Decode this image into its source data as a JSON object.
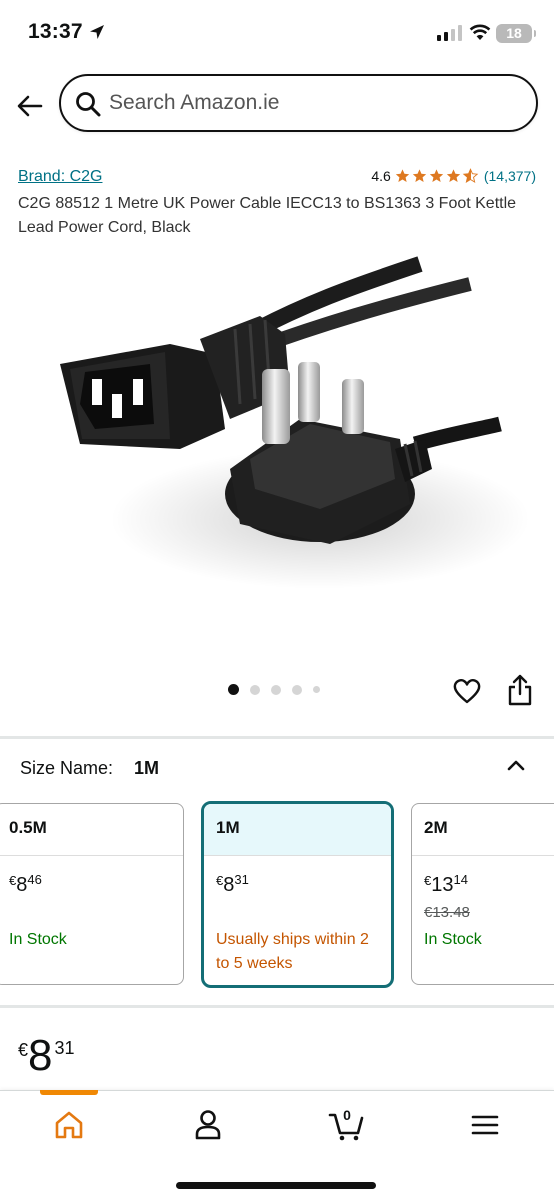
{
  "status_bar": {
    "time": "13:37",
    "battery": "18"
  },
  "search": {
    "placeholder": "Search Amazon.ie"
  },
  "product": {
    "brand": "Brand: C2G",
    "rating": "4.6",
    "rating_stars": 4.5,
    "rating_count": "(14,377)",
    "title": "C2G 88512 1 Metre UK Power Cable IECC13 to BS1363 3 Foot Kettle Lead Power Cord, Black",
    "image_icon": "power-cable-image",
    "image_count": 5,
    "active_image": 1
  },
  "size_selector": {
    "label": "Size Name:",
    "selected": "1M",
    "options": [
      {
        "name": "0.5M",
        "currency": "€",
        "whole": "8",
        "cents": "46",
        "was": "",
        "stock": "In Stock"
      },
      {
        "name": "1M",
        "currency": "€",
        "whole": "8",
        "cents": "31",
        "was": "",
        "stock": "Usually ships within 2 to 5 weeks"
      },
      {
        "name": "2M",
        "currency": "€",
        "whole": "13",
        "cents": "14",
        "was": "€13.48",
        "stock": "In Stock"
      }
    ]
  },
  "price": {
    "currency": "€",
    "whole": "8",
    "cents": "31"
  },
  "bottom_nav": {
    "cart_count": "0",
    "items": [
      "home-icon",
      "account-icon",
      "cart-icon",
      "menu-icon"
    ]
  },
  "colors": {
    "link": "#007185",
    "star": "#de7921",
    "in_stock": "#007600",
    "ships_later": "#c45500",
    "selected_border": "#146e76",
    "nav_accent": "#f08804"
  }
}
